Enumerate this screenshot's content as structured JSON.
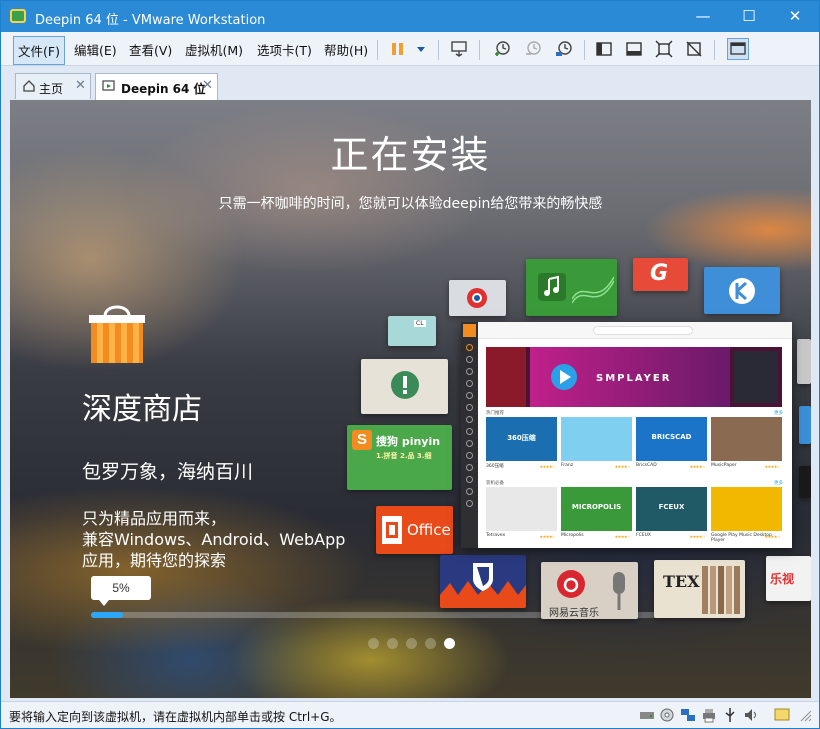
{
  "window": {
    "title": "Deepin 64 位 - VMware Workstation",
    "minimize_glyph": "—",
    "maximize_glyph": "☐",
    "close_glyph": "✕"
  },
  "menu": {
    "items": [
      "文件(F)",
      "编辑(E)",
      "查看(V)",
      "虚拟机(M)",
      "选项卡(T)",
      "帮助(H)"
    ]
  },
  "tabs": [
    {
      "label": "主页",
      "close": "✕",
      "active": false,
      "icon": "home-icon"
    },
    {
      "label": "Deepin 64 位",
      "close": "✕",
      "active": true,
      "icon": "vm-running-icon"
    }
  ],
  "installer": {
    "heading": "正在安装",
    "subheading": "只需一杯咖啡的时间，您就可以体验deepin给您带来的畅快感",
    "store_title": "深度商店",
    "store_tagline": "包罗万象，海纳百川",
    "store_desc_lines": [
      "只为精品应用而来，",
      "兼容Windows、Android、WebApp",
      "应用，期待您的探索"
    ],
    "progress_label": "5%",
    "progress": 0.05,
    "slide_count": 5,
    "active_slide": 4
  },
  "tiles": {
    "sogou_title": "搜狗 pinyin",
    "sogou_sub": "1.拼音 2.品 3.细",
    "office": "Office",
    "netease": "网易云音乐",
    "tex": "TEX",
    "lesee": "乐视"
  },
  "store_window": {
    "banner_text": "SMPLAYER",
    "section1": "热门推荐",
    "section2": "装机必备",
    "more": "更多",
    "row1": [
      {
        "name": "360压缩",
        "thumb_text": "360压缩",
        "bg": "#1b6fb0"
      },
      {
        "name": "Franz",
        "thumb_text": "",
        "bg": "#7fd0f0"
      },
      {
        "name": "BricsCAD",
        "thumb_text": "BRICSCAD",
        "bg": "#1c74c9"
      },
      {
        "name": "MusicPaper",
        "thumb_text": "",
        "bg": "#8b6a52"
      }
    ],
    "row2": [
      {
        "name": "Tetravex",
        "thumb_text": "",
        "bg": "#e8e8e8"
      },
      {
        "name": "Micropolis",
        "thumb_text": "MICROPOLIS",
        "bg": "#3a9a3a"
      },
      {
        "name": "FCEUX",
        "thumb_text": "FCEUX",
        "bg": "#1f5a66"
      },
      {
        "name": "Google Play Music Desktop Player",
        "thumb_text": "",
        "bg": "#f2b800"
      }
    ],
    "stars": "★★★★☆"
  },
  "status": {
    "text": "要将输入定向到该虚拟机，请在虚拟机内部单击或按 Ctrl+G。"
  },
  "colors": {
    "titlebar": "#2b8ad6",
    "accent_progress": "#2ca7f8",
    "store_orange": "#f28c20"
  }
}
